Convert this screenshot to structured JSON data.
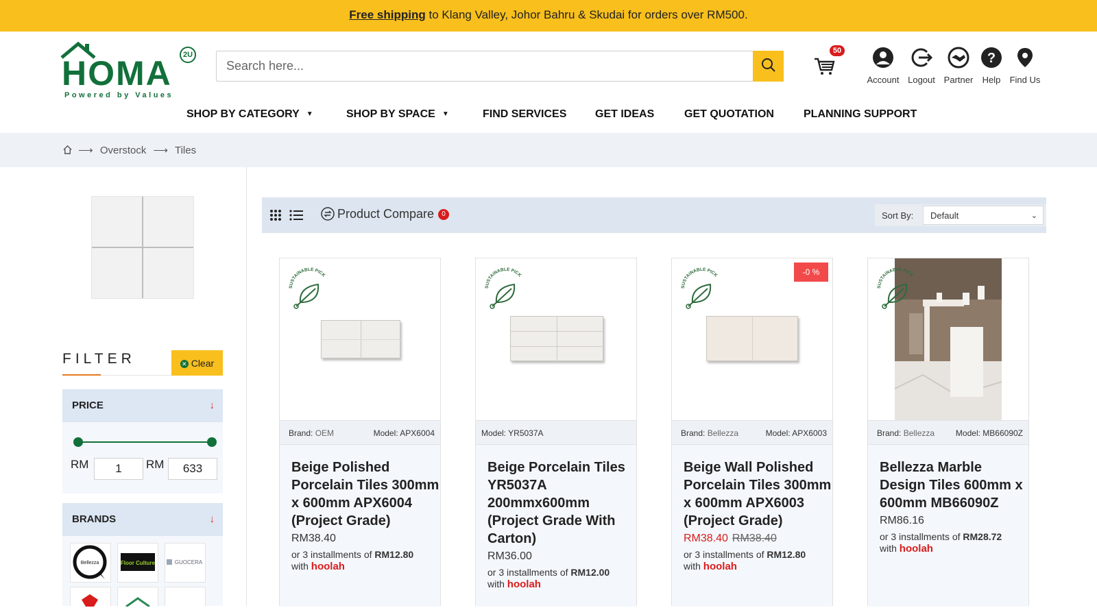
{
  "announcement": {
    "bold": "Free shipping",
    "rest": " to Klang Valley, Johor Bahru & Skudai for orders over RM500."
  },
  "logo": {
    "brand": "HOMA",
    "badge": "2U",
    "tagline": "Powered by Values"
  },
  "search": {
    "placeholder": "Search here..."
  },
  "cart": {
    "count": "50"
  },
  "header_icons": [
    {
      "label": "Account",
      "icon": "account-icon"
    },
    {
      "label": "Logout",
      "icon": "logout-icon"
    },
    {
      "label": "Partner",
      "icon": "handshake-icon"
    },
    {
      "label": "Help",
      "icon": "help-icon"
    },
    {
      "label": "Find Us",
      "icon": "location-pin-icon"
    }
  ],
  "nav": [
    {
      "label": "SHOP BY CATEGORY",
      "dropdown": true
    },
    {
      "label": "SHOP BY SPACE",
      "dropdown": true
    },
    {
      "label": "FIND SERVICES"
    },
    {
      "label": "GET IDEAS"
    },
    {
      "label": "GET QUOTATION"
    },
    {
      "label": "PLANNING SUPPORT"
    }
  ],
  "breadcrumb": {
    "items": [
      "Overstock",
      "Tiles"
    ],
    "separator": "⟶"
  },
  "filter": {
    "title": "FILTER",
    "clear_label": "Clear",
    "price": {
      "label": "PRICE",
      "currency": "RM",
      "min": "1",
      "max": "633"
    },
    "brands": {
      "label": "BRANDS",
      "logos": [
        "Bellezza",
        "Floor Culture",
        "GUOCERA"
      ]
    }
  },
  "toolbar": {
    "compare_label": "Product Compare",
    "compare_count": "0",
    "sort_label": "Sort By:",
    "sort_value": "Default"
  },
  "products": [
    {
      "brand_label": "Brand:",
      "brand": "OEM",
      "model_label": "Model:",
      "model": "APX6004",
      "name": "Beige Polished Porcelain Tiles 300mm x 600mm APX6004 (Project Grade)",
      "price": "RM38.40",
      "installment_prefix": "or 3 installments of ",
      "installment": "RM12.80",
      "with": "with ",
      "provider": "hoolah",
      "sustainable": true
    },
    {
      "brand_label": "",
      "brand": "",
      "model_label": "Model:",
      "model": "YR5037A",
      "name": "Beige Porcelain Tiles YR5037A 200mmx600mm (Project Grade With Carton)",
      "price": "RM36.00",
      "installment_prefix": "or 3 installments of ",
      "installment": "RM12.00",
      "with": "with ",
      "provider": "hoolah",
      "sustainable": true
    },
    {
      "brand_label": "Brand:",
      "brand": "Bellezza",
      "model_label": "Model:",
      "model": "APX6003",
      "name": "Beige Wall Polished Porcelain Tiles 300mm x 600mm APX6003 (Project Grade)",
      "price": "RM38.40",
      "old_price": "RM38.40",
      "discount": "-0 %",
      "installment_prefix": "or 3 installments of ",
      "installment": "RM12.80",
      "with": "with ",
      "provider": "hoolah",
      "sustainable": true
    },
    {
      "brand_label": "Brand:",
      "brand": "Bellezza",
      "model_label": "Model:",
      "model": "MB66090Z",
      "name": "Bellezza Marble Design Tiles 600mm x 600mm MB66090Z",
      "price": "RM86.16",
      "installment_prefix": "or 3 installments of ",
      "installment": "RM28.72",
      "with": "with ",
      "provider": "hoolah",
      "sustainable": true
    }
  ],
  "sustainable_badge": "SUSTAINABLE PICK",
  "colors": {
    "accent": "#f8bf1d",
    "brand_green": "#12703a",
    "sale_red": "#d91c1c",
    "panel_blue": "#dde6f3"
  }
}
